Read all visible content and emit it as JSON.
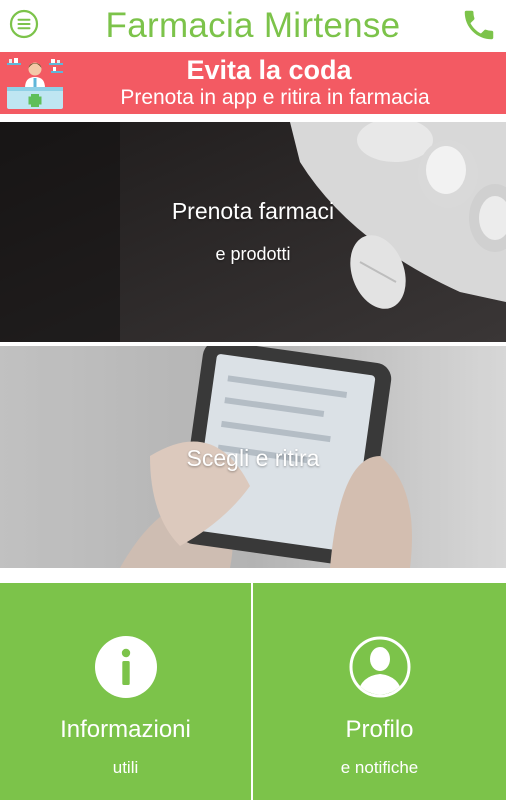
{
  "header": {
    "title": "Farmacia Mirtense",
    "menu_icon": "hamburger-circle-icon",
    "phone_icon": "phone-icon",
    "accent_color": "#7cc34a"
  },
  "banner": {
    "title": "Evita la coda",
    "subtitle": "Prenota in app e ritira in farmacia",
    "background_color": "#f35a63",
    "illustration": "pharmacist-counter-illustration"
  },
  "tiles": [
    {
      "title": "Prenota farmaci",
      "subtitle": "e prodotti"
    },
    {
      "title": "Scegli e ritira"
    }
  ],
  "panels": [
    {
      "title": "Informazioni",
      "subtitle": "utili",
      "icon": "info-icon"
    },
    {
      "title": "Profilo",
      "subtitle": "e notifiche",
      "icon": "user-icon"
    }
  ]
}
